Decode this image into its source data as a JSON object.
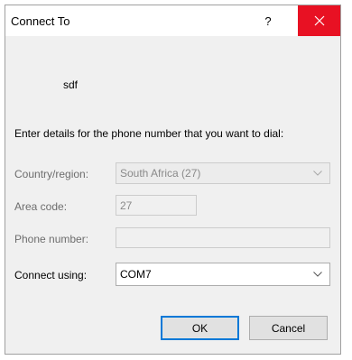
{
  "window": {
    "title": "Connect To",
    "help_label": "?",
    "close_color": "#e81123",
    "accent_color": "#0078d7"
  },
  "device_name": "sdf",
  "instruction": "Enter details for the phone number that you want to dial:",
  "fields": {
    "country": {
      "label": "Country/region:",
      "value": "South Africa (27)"
    },
    "area_code": {
      "label": "Area code:",
      "value": "27"
    },
    "phone_number": {
      "label": "Phone number:",
      "value": ""
    },
    "connect_using": {
      "label": "Connect using:",
      "value": "COM7"
    }
  },
  "buttons": {
    "ok": "OK",
    "cancel": "Cancel"
  }
}
